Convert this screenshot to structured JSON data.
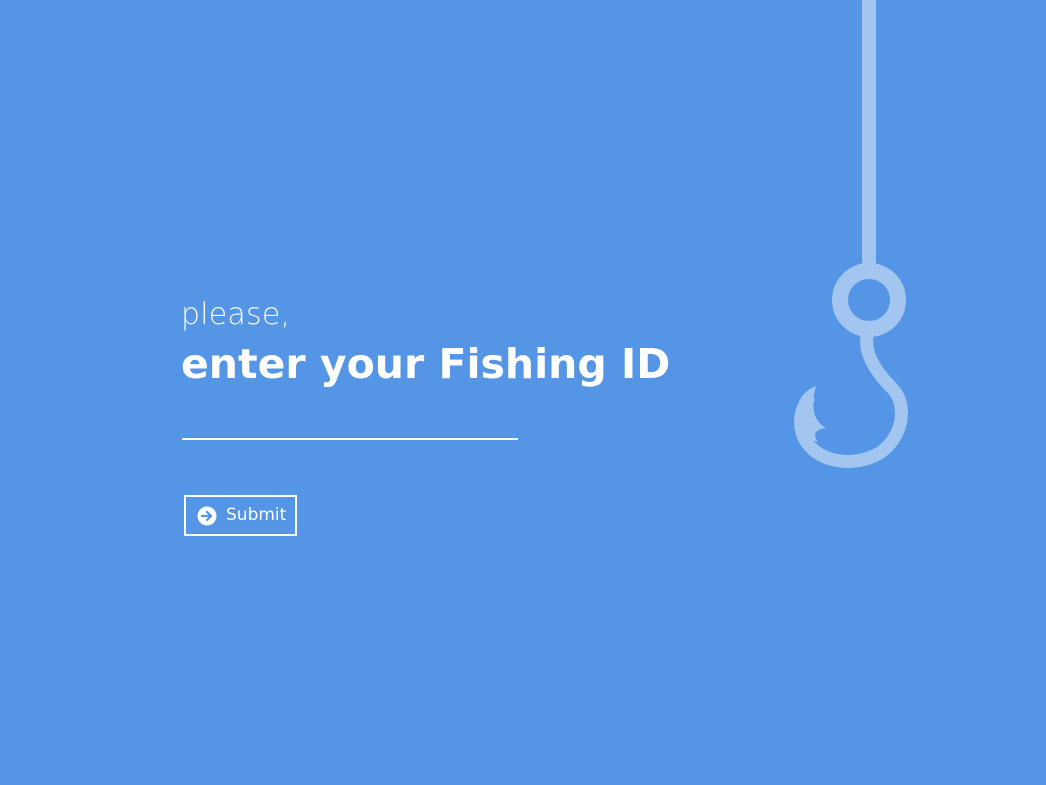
{
  "prompt": {
    "intro": "please,",
    "title": "enter your Fishing ID"
  },
  "form": {
    "id_input_value": "",
    "submit_label": "Submit",
    "submit_icon": "arrow-right-circle-icon"
  },
  "decoration": {
    "icon": "fishing-hook-icon"
  },
  "colors": {
    "background": "#5595e5",
    "foreground": "#ffffff",
    "hook": "#a3c6f0"
  }
}
